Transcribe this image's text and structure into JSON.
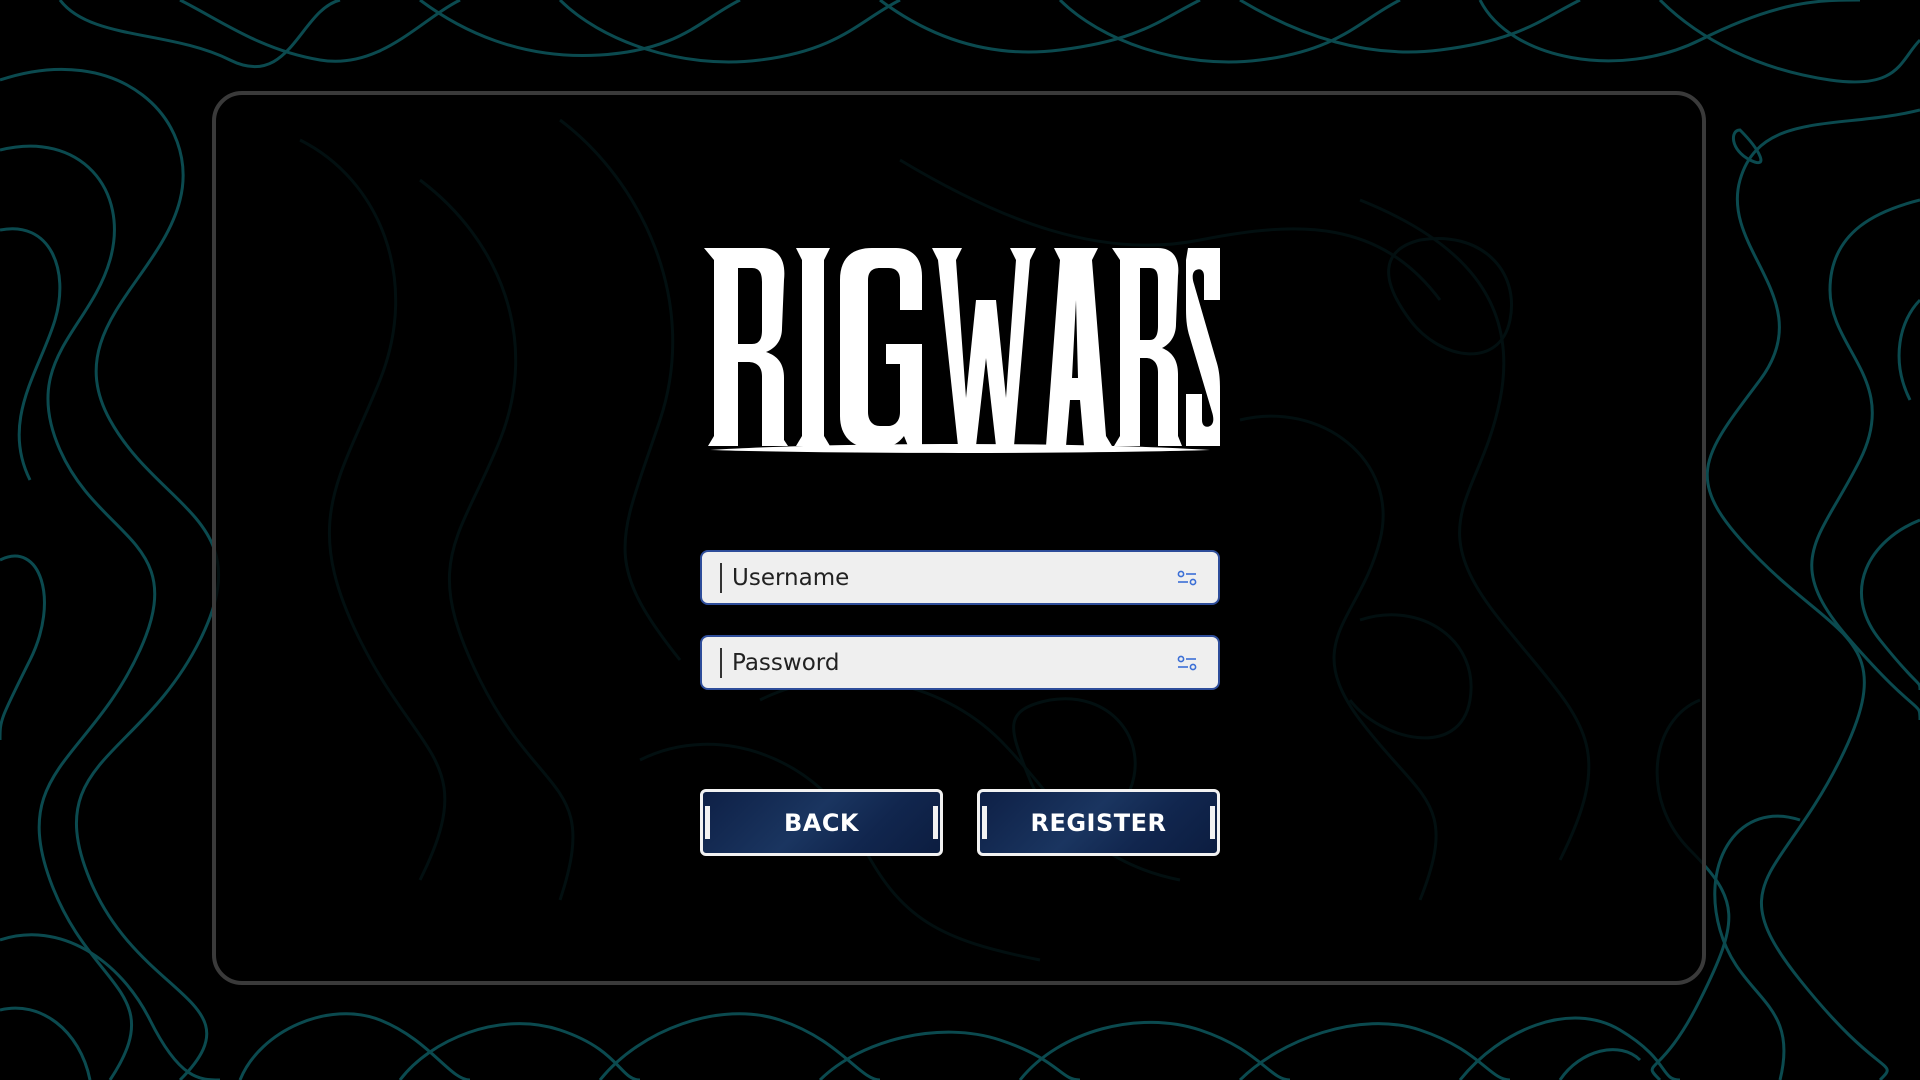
{
  "app": {
    "logo_text": "RIG WARS"
  },
  "form": {
    "username": {
      "placeholder": "Username",
      "icon": "sliders-icon"
    },
    "password": {
      "placeholder": "Password",
      "icon": "sliders-icon"
    }
  },
  "buttons": {
    "back_label": "BACK",
    "register_label": "REGISTER"
  },
  "colors": {
    "background": "#000000",
    "contour_lines": "#0b4a4f",
    "panel_border": "#3a3a3a",
    "input_bg": "#efefef",
    "input_border": "#2e4d9a",
    "button_bg": "#14284f",
    "button_border": "#f2f2f2",
    "icon_accent": "#3b6fd6"
  }
}
